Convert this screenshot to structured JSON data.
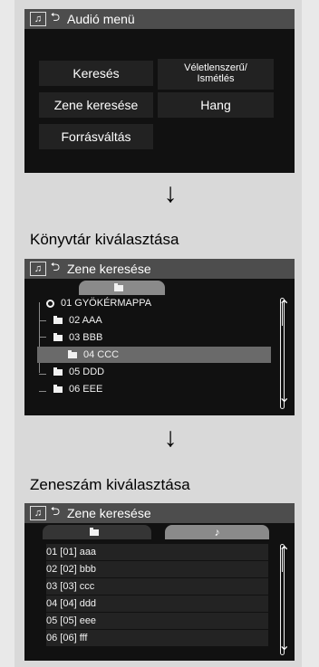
{
  "screens": [
    {
      "title": "Audió menü",
      "menu": {
        "items": [
          {
            "label": "Keresés"
          },
          {
            "label": "Véletlenszerű/\nIsmétlés"
          },
          {
            "label": "Zene keresése"
          },
          {
            "label": "Hang"
          },
          {
            "label": "Forrásváltás"
          }
        ]
      }
    },
    {
      "caption": "Könyvtár kiválasztása",
      "title": "Zene keresése",
      "tab_icon": "folder-icon",
      "items": [
        {
          "label": "01 GYÖKÉRMAPPA"
        },
        {
          "label": "02 AAA"
        },
        {
          "label": "03 BBB"
        },
        {
          "label": "04 CCC"
        },
        {
          "label": "05 DDD"
        },
        {
          "label": "06 EEE"
        }
      ],
      "selected_item": "04 CCC"
    },
    {
      "caption": "Zeneszám kiválasztása",
      "title": "Zene keresése",
      "tabs": [
        {
          "label": "folder-icon"
        },
        {
          "label": "music-note-icon"
        }
      ],
      "tracks": [
        {
          "label": "01 [01] aaa"
        },
        {
          "label": "02 [02] bbb"
        },
        {
          "label": "03 [03] ccc"
        },
        {
          "label": "04 [04] ddd"
        },
        {
          "label": "05 [05] eee"
        },
        {
          "label": "06 [06] fff"
        }
      ]
    }
  ],
  "icons": {
    "music": "music-note-icon",
    "back": "back-arrow-icon",
    "folder": "folder-icon",
    "disc": "disc-icon",
    "scroll_up": "chevron-up-icon",
    "scroll_down": "chevron-down-icon",
    "flow": "down-arrow-icon"
  },
  "colors": {
    "background": "#111111",
    "titlebar": "#4d4d4d",
    "selected": "#6a6a6a"
  }
}
